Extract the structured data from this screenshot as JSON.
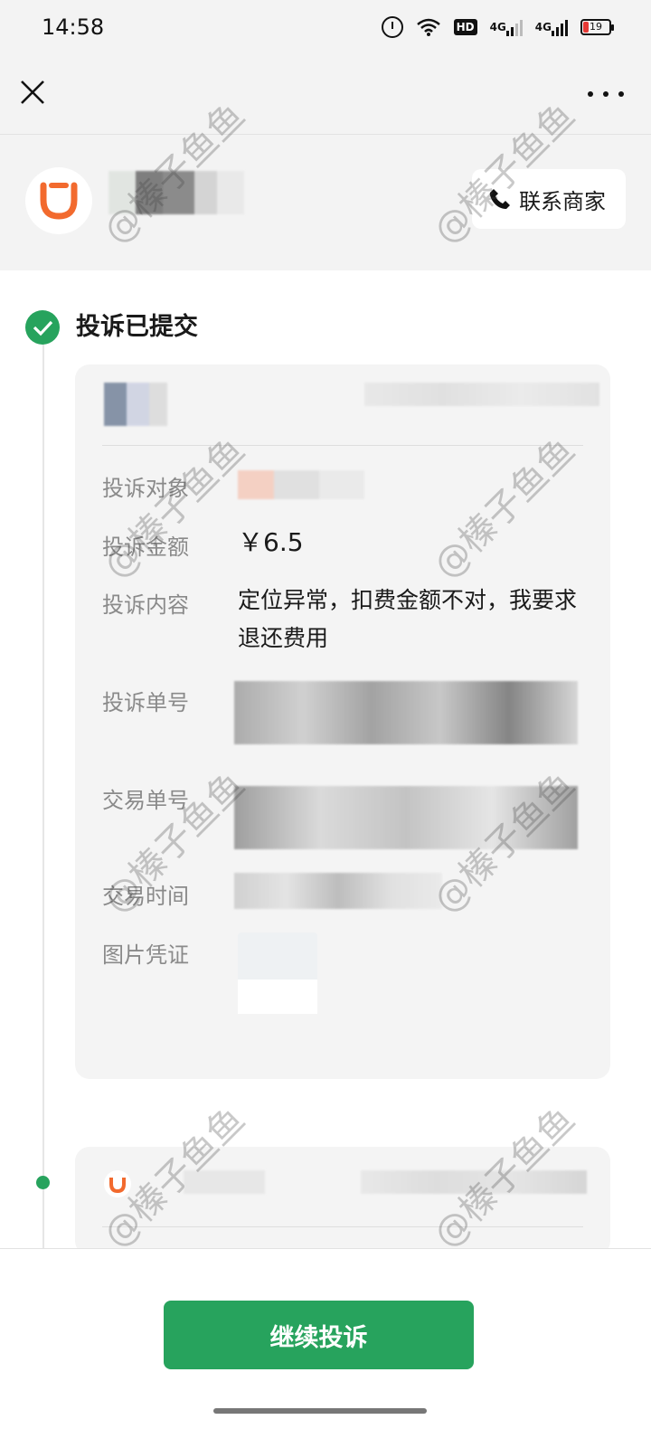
{
  "status_bar": {
    "time": "14:58",
    "hd_label": "HD",
    "signal1_label": "4G",
    "signal2_label": "4G",
    "battery": "19"
  },
  "merchant": {
    "contact_label": "联系商家"
  },
  "step": {
    "title": "投诉已提交"
  },
  "details": {
    "rows": [
      {
        "label": "投诉对象",
        "value": ""
      },
      {
        "label": "投诉金额",
        "value": "￥6.5"
      },
      {
        "label": "投诉内容",
        "value": "定位异常，扣费金额不对，我要求退还费用"
      },
      {
        "label": "投诉单号",
        "value": ""
      },
      {
        "label": "交易单号",
        "value": ""
      },
      {
        "label": "交易时间",
        "value": ""
      },
      {
        "label": "图片凭证",
        "value": ""
      }
    ]
  },
  "bottom": {
    "continue_label": "继续投诉"
  },
  "watermark": "@榛子鱼鱼",
  "colors": {
    "accent_green": "#27a35d",
    "brand_orange": "#f26a2e",
    "background_gray": "#f3f3f3"
  }
}
